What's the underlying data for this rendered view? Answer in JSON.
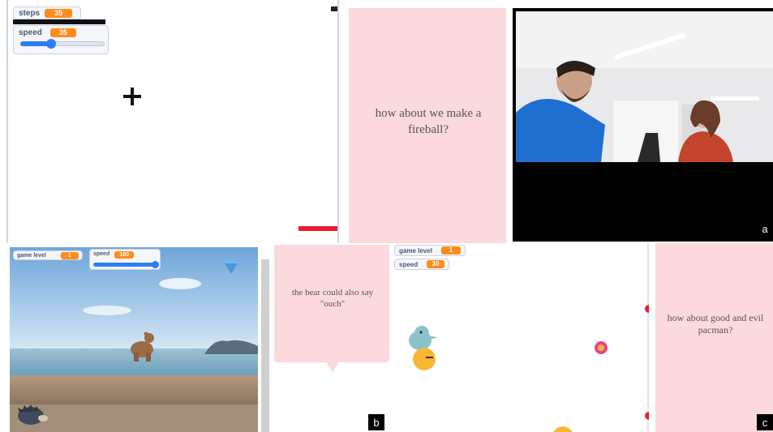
{
  "panel_a": {
    "monitors": {
      "steps": {
        "label": "steps",
        "value": "35"
      },
      "speed": {
        "label": "speed",
        "value": "35",
        "slider_fraction": 0.35
      }
    },
    "suggestion": "how about we make a fireball?",
    "tag": "a"
  },
  "panel_b": {
    "monitors": {
      "game_level": {
        "label": "game level",
        "value": "1"
      },
      "speed": {
        "label": "speed",
        "value": "100",
        "slider_fraction": 1.0
      }
    },
    "suggestion": "the bear could also say \"ouch\"",
    "tag": "b"
  },
  "panel_c": {
    "monitors": {
      "game_level": {
        "label": "game level",
        "value": "1"
      },
      "speed": {
        "label": "speed",
        "value": "30"
      }
    },
    "suggestion": "how about good and evil pacman?",
    "tag": "c"
  },
  "colors": {
    "suggestion_bg": "#fbd9dc",
    "monitor_value": "#ff8c1a",
    "slider": "#2d7df6",
    "red_bar": "#e8202a"
  },
  "icons": [
    "crosshair-icon",
    "diamond-icon",
    "bear-sprite",
    "hedgehog-sprite",
    "bird-sprite",
    "pacman-sprite",
    "pink-ball-sprite"
  ]
}
